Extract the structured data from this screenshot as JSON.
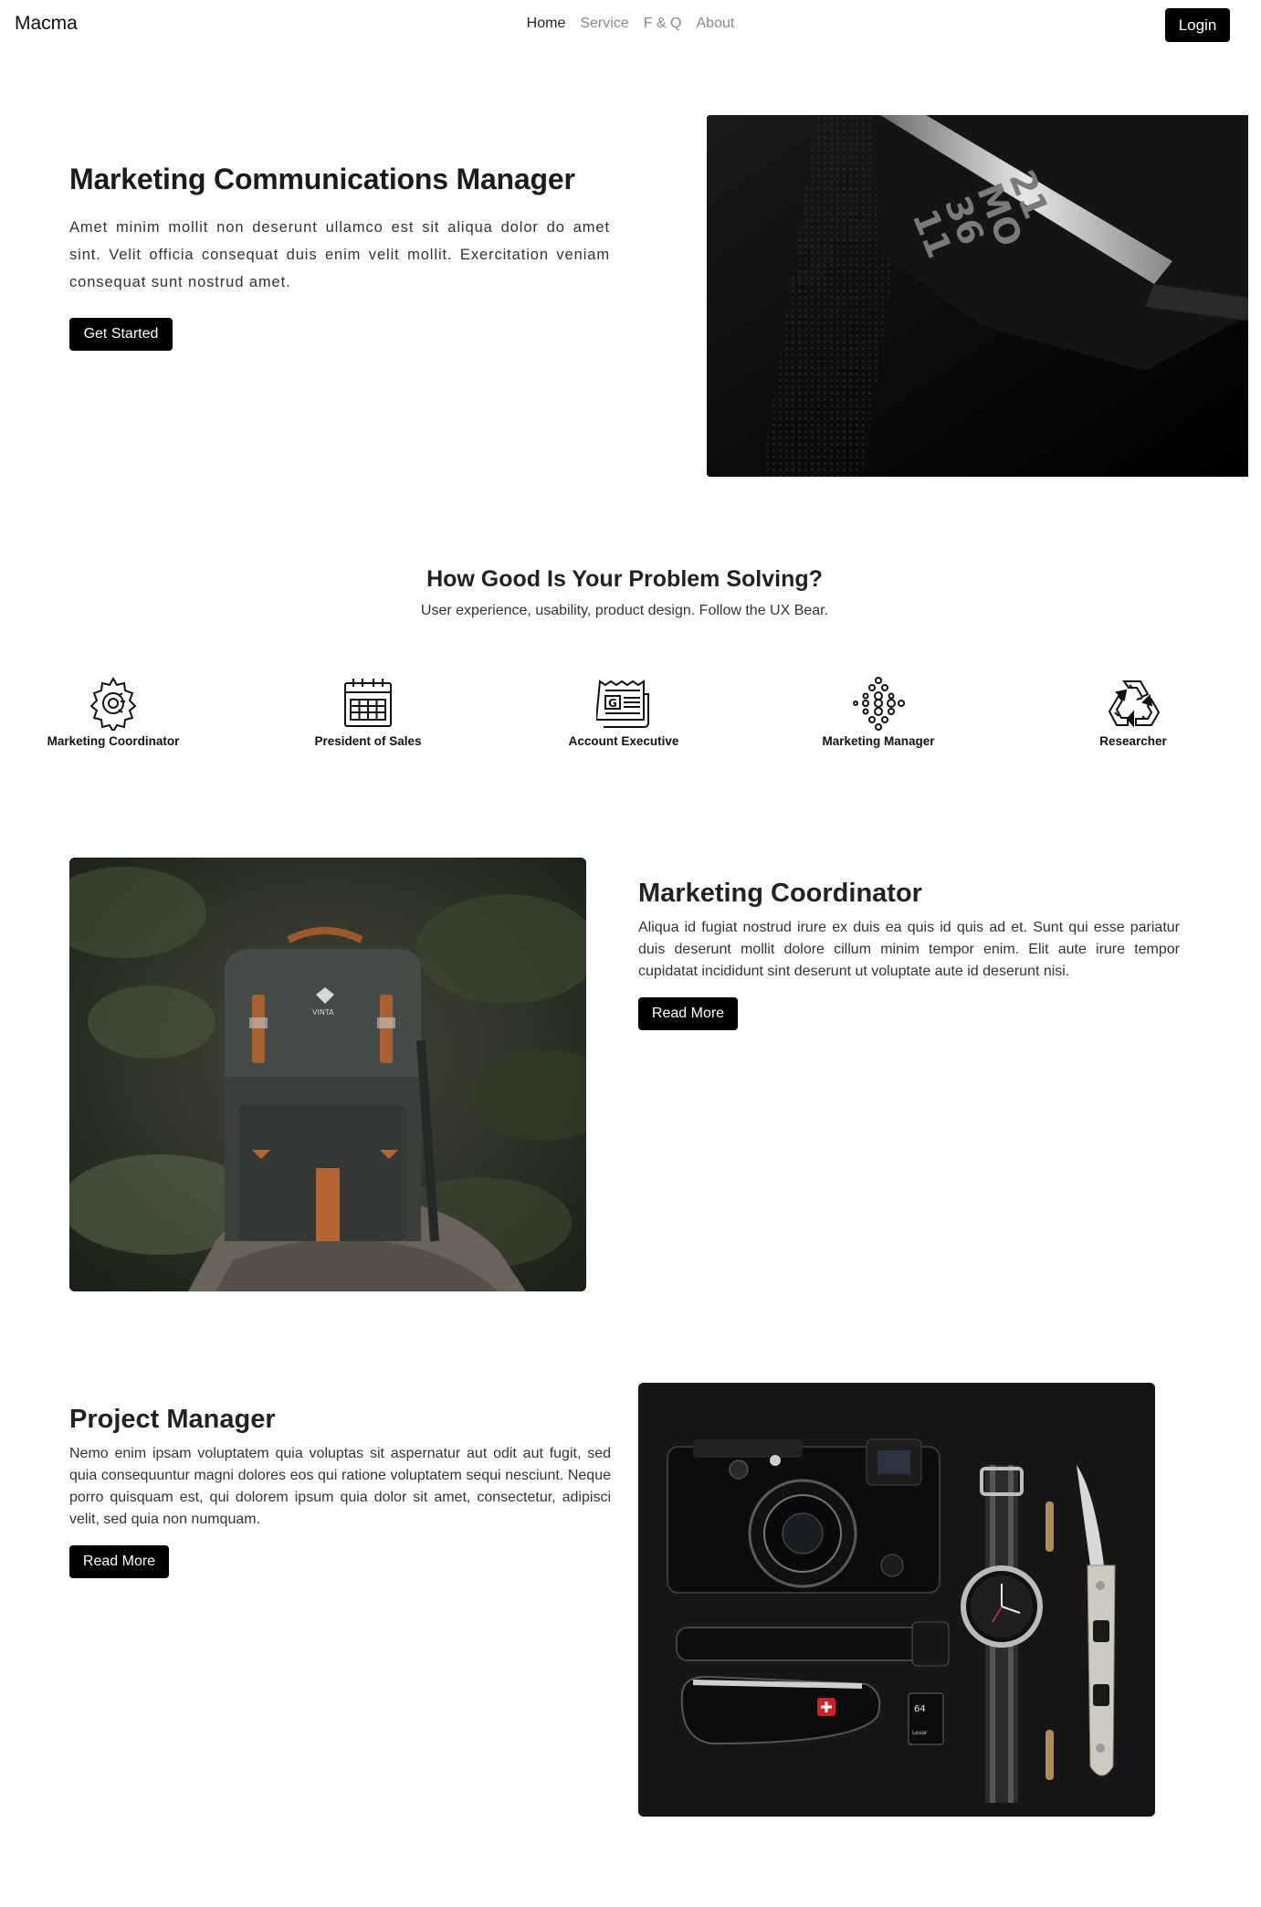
{
  "brand": "Macma",
  "nav": {
    "items": [
      {
        "label": "Home",
        "active": true
      },
      {
        "label": "Service",
        "active": false
      },
      {
        "label": "F & Q",
        "active": false
      },
      {
        "label": "About",
        "active": false
      }
    ],
    "login_label": "Login"
  },
  "hero": {
    "title": "Marketing Communications Manager",
    "text": "Amet minim mollit non deserunt ullamco est sit aliqua dolor do amet sint. Velit officia consequat duis enim velit mollit. Exercitation veniam consequat sunt nostrud amet.",
    "button_label": "Get Started",
    "image": "fitness-tracker-band-photo"
  },
  "problem_section": {
    "title": "How Good Is Your Problem Solving?",
    "subtitle": "User experience, usability, product design. Follow the UX Bear."
  },
  "features": [
    {
      "label": "Marketing Coordinator",
      "icon": "gear-icon"
    },
    {
      "label": "President of Sales",
      "icon": "calendar-icon"
    },
    {
      "label": "Account Executive",
      "icon": "newspaper-icon"
    },
    {
      "label": "Marketing Manager",
      "icon": "dots-pattern-icon"
    },
    {
      "label": "Researcher",
      "icon": "recycle-icon"
    }
  ],
  "cards": [
    {
      "title": "Marketing Coordinator",
      "text": "Aliqua id fugiat nostrud irure ex duis ea quis id quis ad et. Sunt qui esse pariatur duis deserunt mollit dolore cillum minim tempor enim. Elit aute irure tempor cupidatat incididunt sint deserunt ut voluptate aute id deserunt nisi.",
      "button_label": "Read More",
      "image": "backpack-on-rock-photo"
    },
    {
      "title": "Project Manager",
      "text": "Nemo enim ipsam voluptatem quia voluptas sit aspernatur aut odit aut fugit, sed quia consequuntur magni dolores eos qui ratione voluptatem sequi nesciunt. Neque porro quisquam est, qui dolorem ipsum quia dolor sit amet, consectetur, adipisci velit, sed quia non numquam.",
      "button_label": "Read More",
      "image": "camera-watch-knife-flatlay-photo"
    }
  ],
  "colors": {
    "button_bg": "#000000",
    "nav_inactive": "#8a8a8a"
  }
}
